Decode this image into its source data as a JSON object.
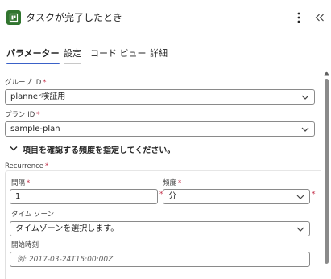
{
  "header": {
    "title": "タスクが完了したとき",
    "more_icon": "more-vertical-icon",
    "collapse_icon": "double-chevron-left-icon",
    "app_icon": "planner-icon",
    "app_color": "#31752f"
  },
  "tabs": [
    {
      "label": "パラメーター",
      "state": "active"
    },
    {
      "label": "設定",
      "state": "hover"
    },
    {
      "label": "コード ビュー",
      "state": "normal"
    },
    {
      "label": "詳細",
      "state": "normal"
    }
  ],
  "form": {
    "group_id": {
      "label": "グループ ID",
      "required": "*",
      "value": "planner検証用"
    },
    "plan_id": {
      "label": "プラン ID",
      "required": "*",
      "value": "sample-plan"
    },
    "frequency_prompt": "項目を確認する頻度を指定してください。",
    "recurrence": {
      "label": "Recurrence",
      "required": "*",
      "interval": {
        "label": "間隔",
        "required": "*",
        "value": "1"
      },
      "frequency": {
        "label": "頻度",
        "required": "*",
        "value": "分"
      },
      "timezone": {
        "label": "タイム ゾーン",
        "value": "タイムゾーンを選択します。"
      },
      "start_time": {
        "label": "開始時刻",
        "placeholder": "例: 2017-03-24T15:00:00Z"
      }
    }
  },
  "colors": {
    "accent": "#3a61c8",
    "required": "#c4314b",
    "border": "#8a8a8a"
  }
}
